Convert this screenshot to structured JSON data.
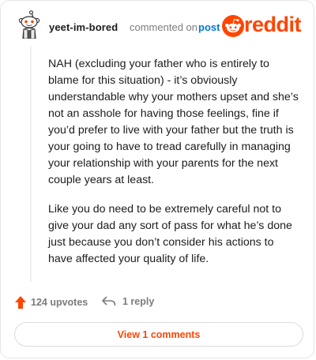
{
  "comment": {
    "username": "yeet-im-bored",
    "commented_text": "commented on",
    "post_link": "post",
    "paragraphs": [
      "NAH (excluding your father who is entirely to blame for this situation) - it’s obviously understandable why your mothers upset and she’s not an asshole for having those feelings, fine if you’d prefer to live with your father but the truth is your going to have to tread carefully in managing your relationship with your parents for the next couple years at least.",
      "Like you do need to be extremely careful not to give your dad any sort of pass for what he’s done just because you don’t consider his actions to have affected your quality of life."
    ]
  },
  "brand": {
    "logo_text": "reddit",
    "logo_icon": "reddit-alien-icon",
    "color": "#ff4500"
  },
  "actions": {
    "upvotes_label": "124 upvotes",
    "upvote_icon": "upvote-arrow-icon",
    "reply_label": "1 reply",
    "reply_icon": "reply-arrow-icon"
  },
  "footer": {
    "view_comments_label": "View 1 comments"
  }
}
